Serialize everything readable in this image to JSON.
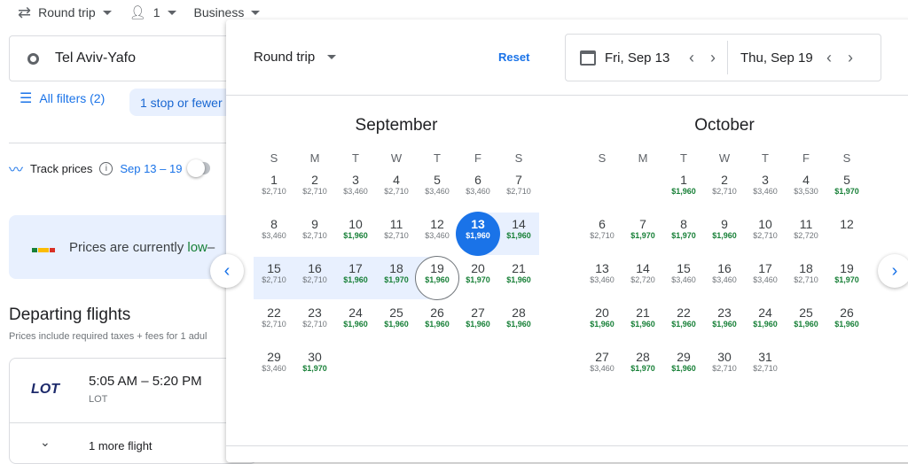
{
  "topbar": {
    "trip_type": "Round trip",
    "passengers": "1",
    "cabin": "Business"
  },
  "search": {
    "origin": "Tel Aviv-Yafo"
  },
  "filters": {
    "all_filters": "All filters (2)",
    "stops_chip": "1 stop or fewer"
  },
  "track": {
    "label": "Track prices",
    "dates": "Sep 13 – 19"
  },
  "banner": {
    "text_prefix": "Prices are currently ",
    "level": "low",
    "suffix": " –"
  },
  "departing": {
    "title": "Departing flights",
    "subtitle": "Prices include required taxes + fees for 1 adul",
    "flight_time": "5:05 AM – 5:20 PM",
    "airline": "LOT",
    "airline_logo": "LOT",
    "more": "1 more flight"
  },
  "panel": {
    "trip_type": "Round trip",
    "reset": "Reset",
    "depart_date": "Fri, Sep 13",
    "return_date": "Thu, Sep 19"
  },
  "calendar": {
    "weekdays": [
      "S",
      "M",
      "T",
      "W",
      "T",
      "F",
      "S"
    ],
    "selected_depart": 13,
    "selected_return": 19,
    "colors": {
      "accent": "#1a73e8",
      "low_price": "#188038",
      "range": "#e8f0fe"
    },
    "months": [
      {
        "name": "September",
        "offset": 0,
        "days": [
          {
            "day": "1",
            "price": "$2,710",
            "low": false
          },
          {
            "day": "2",
            "price": "$2,710",
            "low": false
          },
          {
            "day": "3",
            "price": "$3,460",
            "low": false
          },
          {
            "day": "4",
            "price": "$2,710",
            "low": false
          },
          {
            "day": "5",
            "price": "$3,460",
            "low": false
          },
          {
            "day": "6",
            "price": "$3,460",
            "low": false
          },
          {
            "day": "7",
            "price": "$2,710",
            "low": false
          },
          {
            "day": "8",
            "price": "$3,460",
            "low": false
          },
          {
            "day": "9",
            "price": "$2,710",
            "low": false
          },
          {
            "day": "10",
            "price": "$1,960",
            "low": true
          },
          {
            "day": "11",
            "price": "$2,710",
            "low": false
          },
          {
            "day": "12",
            "price": "$3,460",
            "low": false
          },
          {
            "day": "13",
            "price": "$1,960",
            "low": true
          },
          {
            "day": "14",
            "price": "$1,960",
            "low": true
          },
          {
            "day": "15",
            "price": "$2,710",
            "low": false
          },
          {
            "day": "16",
            "price": "$2,710",
            "low": false
          },
          {
            "day": "17",
            "price": "$1,960",
            "low": true
          },
          {
            "day": "18",
            "price": "$1,970",
            "low": true
          },
          {
            "day": "19",
            "price": "$1,960",
            "low": true
          },
          {
            "day": "20",
            "price": "$1,970",
            "low": true
          },
          {
            "day": "21",
            "price": "$1,960",
            "low": true
          },
          {
            "day": "22",
            "price": "$2,710",
            "low": false
          },
          {
            "day": "23",
            "price": "$2,710",
            "low": false
          },
          {
            "day": "24",
            "price": "$1,960",
            "low": true
          },
          {
            "day": "25",
            "price": "$1,960",
            "low": true
          },
          {
            "day": "26",
            "price": "$1,960",
            "low": true
          },
          {
            "day": "27",
            "price": "$1,960",
            "low": true
          },
          {
            "day": "28",
            "price": "$1,960",
            "low": true
          },
          {
            "day": "29",
            "price": "$3,460",
            "low": false
          },
          {
            "day": "30",
            "price": "$1,970",
            "low": true
          }
        ]
      },
      {
        "name": "October",
        "offset": 2,
        "days": [
          {
            "day": "1",
            "price": "$1,960",
            "low": true
          },
          {
            "day": "2",
            "price": "$2,710",
            "low": false
          },
          {
            "day": "3",
            "price": "$3,460",
            "low": false
          },
          {
            "day": "4",
            "price": "$3,530",
            "low": false
          },
          {
            "day": "5",
            "price": "$1,970",
            "low": true
          },
          {
            "day": "6",
            "price": "$2,710",
            "low": false
          },
          {
            "day": "7",
            "price": "$1,970",
            "low": true
          },
          {
            "day": "8",
            "price": "$1,970",
            "low": true
          },
          {
            "day": "9",
            "price": "$1,960",
            "low": true
          },
          {
            "day": "10",
            "price": "$2,710",
            "low": false
          },
          {
            "day": "11",
            "price": "$2,720",
            "low": false
          },
          {
            "day": "12",
            "price": "",
            "low": false
          },
          {
            "day": "13",
            "price": "$3,460",
            "low": false
          },
          {
            "day": "14",
            "price": "$2,720",
            "low": false
          },
          {
            "day": "15",
            "price": "$3,460",
            "low": false
          },
          {
            "day": "16",
            "price": "$3,460",
            "low": false
          },
          {
            "day": "17",
            "price": "$3,460",
            "low": false
          },
          {
            "day": "18",
            "price": "$2,710",
            "low": false
          },
          {
            "day": "19",
            "price": "$1,970",
            "low": true
          },
          {
            "day": "20",
            "price": "$1,960",
            "low": true
          },
          {
            "day": "21",
            "price": "$1,960",
            "low": true
          },
          {
            "day": "22",
            "price": "$1,960",
            "low": true
          },
          {
            "day": "23",
            "price": "$1,960",
            "low": true
          },
          {
            "day": "24",
            "price": "$1,960",
            "low": true
          },
          {
            "day": "25",
            "price": "$1,960",
            "low": true
          },
          {
            "day": "26",
            "price": "$1,960",
            "low": true
          },
          {
            "day": "27",
            "price": "$3,460",
            "low": false
          },
          {
            "day": "28",
            "price": "$1,970",
            "low": true
          },
          {
            "day": "29",
            "price": "$1,960",
            "low": true
          },
          {
            "day": "30",
            "price": "$2,710",
            "low": false
          },
          {
            "day": "31",
            "price": "$2,710",
            "low": false
          }
        ]
      }
    ]
  }
}
